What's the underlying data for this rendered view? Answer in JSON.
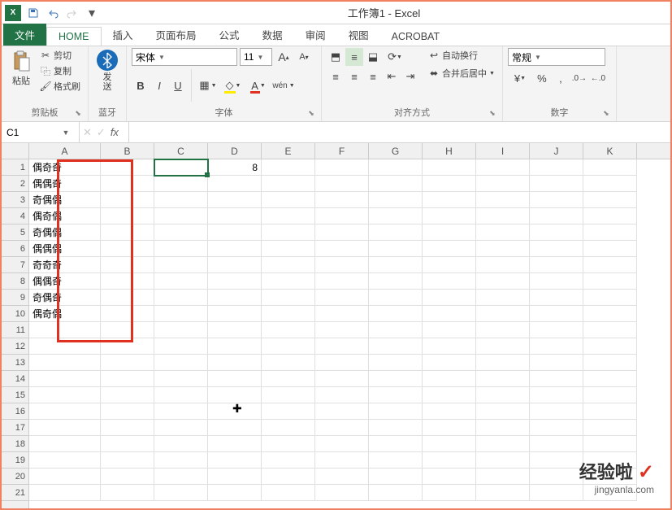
{
  "title": "工作簿1 - Excel",
  "qat": {
    "save": "保存",
    "undo": "撤销",
    "redo": "恢复"
  },
  "tabs": {
    "file": "文件",
    "home": "HOME",
    "insert": "插入",
    "pageLayout": "页面布局",
    "formulas": "公式",
    "data": "数据",
    "review": "审阅",
    "view": "视图",
    "acrobat": "ACROBAT"
  },
  "ribbon": {
    "clipboard": {
      "label": "剪贴板",
      "paste": "粘贴",
      "cut": "剪切",
      "copy": "复制",
      "format": "格式刷"
    },
    "bluetooth": {
      "label": "蓝牙",
      "send": "发\n送"
    },
    "font": {
      "label": "字体",
      "name": "宋体",
      "size": "11"
    },
    "align": {
      "label": "对齐方式",
      "wrap": "自动换行",
      "merge": "合并后居中"
    },
    "number": {
      "label": "数字",
      "format": "常规"
    }
  },
  "nameBox": "C1",
  "formula": "",
  "columns": [
    "A",
    "B",
    "C",
    "D",
    "E",
    "F",
    "G",
    "H",
    "I",
    "J",
    "K"
  ],
  "rowCount": 21,
  "cells": {
    "A1": "偶奇奇",
    "A2": "偶偶奇",
    "A3": "奇偶偶",
    "A4": "偶奇偶",
    "A5": "奇偶偶",
    "A6": "偶偶偶",
    "A7": "奇奇奇",
    "A8": "偶偶奇",
    "A9": "奇偶奇",
    "A10": "偶奇偶",
    "D1": "8"
  },
  "selected": "C1",
  "watermark": {
    "main": "经验啦",
    "sub": "jingyanla.com"
  }
}
